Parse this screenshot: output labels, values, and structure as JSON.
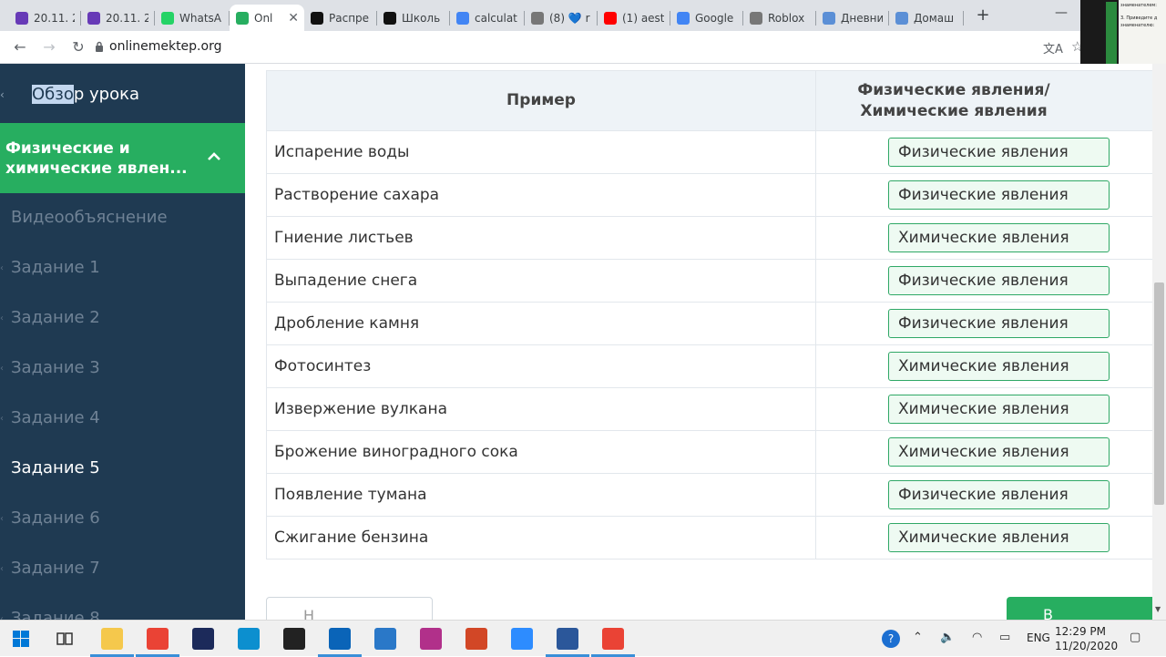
{
  "browser": {
    "tabs": [
      {
        "label": "20.11. 2",
        "icon": "forms-icon",
        "color": "#673ab7"
      },
      {
        "label": "20.11. 2",
        "icon": "forms-icon",
        "color": "#673ab7"
      },
      {
        "label": "WhatsA",
        "icon": "whatsapp-icon",
        "color": "#25d366"
      },
      {
        "label": "Onl",
        "icon": "onlinemektep-icon",
        "color": "#27ae60",
        "active": true
      },
      {
        "label": "Распре",
        "icon": "znanija-icon",
        "color": "#111111"
      },
      {
        "label": "Школь",
        "icon": "znanija-icon",
        "color": "#111111"
      },
      {
        "label": "calculat",
        "icon": "google-icon",
        "color": "#4285f4"
      },
      {
        "label": "(8) 💙 r",
        "icon": "roblox-icon",
        "color": "#777777"
      },
      {
        "label": "(1) aest",
        "icon": "youtube-icon",
        "color": "#ff0000"
      },
      {
        "label": "Google",
        "icon": "translate-icon",
        "color": "#4285f4"
      },
      {
        "label": "Roblox",
        "icon": "roblox-icon",
        "color": "#777777"
      },
      {
        "label": "Дневни",
        "icon": "kundelik-icon",
        "color": "#5b8fd6"
      },
      {
        "label": "Домаш",
        "icon": "kundelik-icon",
        "color": "#5b8fd6"
      }
    ],
    "url": "onlinemektep.org"
  },
  "overlay": {
    "lines": [
      "знаменателем:",
      "3. Приведите д",
      "знаменателю:"
    ]
  },
  "sidebar": {
    "overview_selected": "Обзо",
    "overview_rest": "р урока",
    "section_title": "Физические и химические явлен...",
    "items": [
      {
        "label": "Видеообъяснение"
      },
      {
        "label": "Задание 1"
      },
      {
        "label": "Задание 2"
      },
      {
        "label": "Задание 3"
      },
      {
        "label": "Задание 4"
      },
      {
        "label": "Задание 5",
        "current": true
      },
      {
        "label": "Задание 6"
      },
      {
        "label": "Задание 7"
      },
      {
        "label": "Задание 8"
      }
    ]
  },
  "table": {
    "col1": "Пример",
    "col2": "Физические явления/Химические явления",
    "rows": [
      {
        "example": "Испарение воды",
        "answer": "Физические явления"
      },
      {
        "example": "Растворение сахара",
        "answer": "Физические явления"
      },
      {
        "example": "Гниение листьев",
        "answer": "Химические явления"
      },
      {
        "example": "Выпадение снега",
        "answer": "Физические явления"
      },
      {
        "example": "Дробление камня",
        "answer": "Физические явления"
      },
      {
        "example": "Фотосинтез",
        "answer": "Химические явления"
      },
      {
        "example": "Извержение вулкана",
        "answer": "Химические явления"
      },
      {
        "example": "Брожение виноградного сока",
        "answer": "Химические явления"
      },
      {
        "example": "Появление тумана",
        "answer": "Физические явления"
      },
      {
        "example": "Сжигание бензина",
        "answer": "Химические явления"
      }
    ]
  },
  "nav": {
    "prev": "Н",
    "next": "В"
  },
  "taskbar": {
    "lang": "ENG",
    "time": "12:29 PM",
    "date": "11/20/2020",
    "apps": [
      {
        "name": "file-explorer-icon",
        "color": "#f5c84c"
      },
      {
        "name": "chrome-icon",
        "color": "#ea4335"
      },
      {
        "name": "cinema4d-icon",
        "color": "#1c2a5a"
      },
      {
        "name": "edge-icon",
        "color": "#0c8fcf"
      },
      {
        "name": "media-icon",
        "color": "#222222"
      },
      {
        "name": "outlook-icon",
        "color": "#0a64b8"
      },
      {
        "name": "photos-icon",
        "color": "#2a78c8"
      },
      {
        "name": "app-icon",
        "color": "#b1308a"
      },
      {
        "name": "powerpoint-icon",
        "color": "#d24726"
      },
      {
        "name": "zoom-icon",
        "color": "#2d8cff"
      },
      {
        "name": "word-icon",
        "color": "#2b579a"
      },
      {
        "name": "chrome-icon",
        "color": "#ea4335"
      }
    ]
  }
}
